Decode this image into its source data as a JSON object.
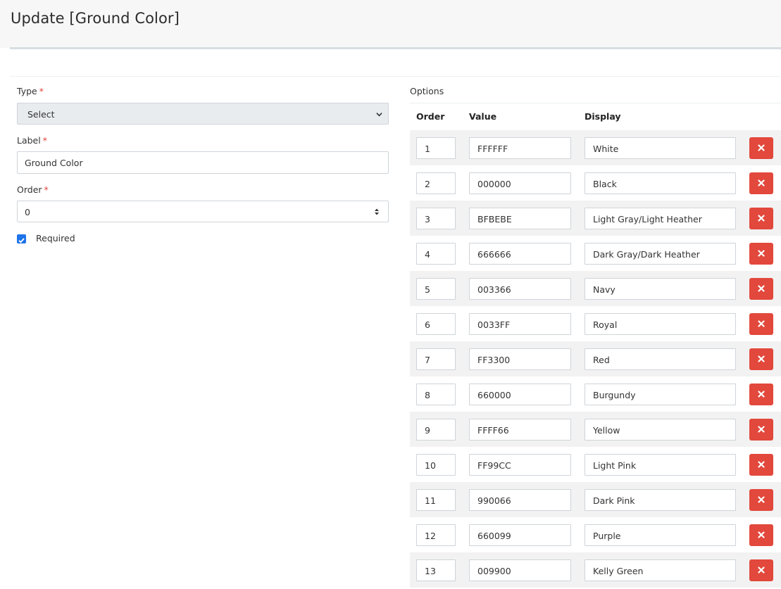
{
  "page": {
    "title": "Update [Ground Color]"
  },
  "form": {
    "type_label": "Type",
    "type_value": "Select",
    "label_label": "Label",
    "label_value": "Ground Color",
    "order_label": "Order",
    "order_value": "0",
    "required_label": "Required",
    "required_checked": true,
    "required_marker": "*"
  },
  "options": {
    "title": "Options",
    "headers": {
      "order": "Order",
      "value": "Value",
      "display": "Display"
    },
    "rows": [
      {
        "order": "1",
        "value": "FFFFFF",
        "display": "White"
      },
      {
        "order": "2",
        "value": "000000",
        "display": "Black"
      },
      {
        "order": "3",
        "value": "BFBEBE",
        "display": "Light Gray/Light Heather"
      },
      {
        "order": "4",
        "value": "666666",
        "display": "Dark Gray/Dark Heather"
      },
      {
        "order": "5",
        "value": "003366",
        "display": "Navy"
      },
      {
        "order": "6",
        "value": "0033FF",
        "display": "Royal"
      },
      {
        "order": "7",
        "value": "FF3300",
        "display": "Red"
      },
      {
        "order": "8",
        "value": "660000",
        "display": "Burgundy"
      },
      {
        "order": "9",
        "value": "FFFF66",
        "display": "Yellow"
      },
      {
        "order": "10",
        "value": "FF99CC",
        "display": "Light Pink"
      },
      {
        "order": "11",
        "value": "990066",
        "display": "Dark Pink"
      },
      {
        "order": "12",
        "value": "660099",
        "display": "Purple"
      },
      {
        "order": "13",
        "value": "009900",
        "display": "Kelly Green"
      }
    ],
    "delete_icon": "close-icon"
  },
  "colors": {
    "accent": "#1e73e8",
    "danger": "#e2483c",
    "required": "#e0443a"
  }
}
